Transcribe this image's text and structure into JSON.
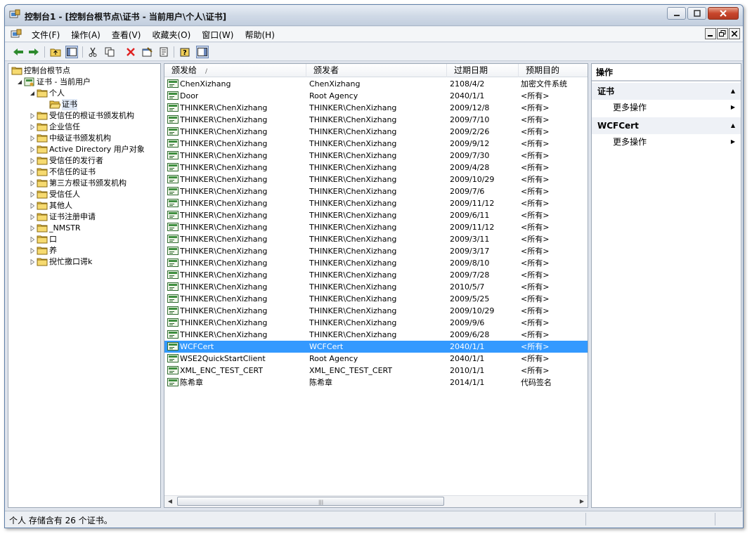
{
  "window": {
    "title": "控制台1 - [控制台根节点\\证书 - 当前用户\\个人\\证书]"
  },
  "menu": [
    "文件(F)",
    "操作(A)",
    "查看(V)",
    "收藏夹(O)",
    "窗口(W)",
    "帮助(H)"
  ],
  "tree": [
    {
      "label": "控制台根节点",
      "level": 0,
      "icon": "folder-icon",
      "twisty": "none"
    },
    {
      "label": "证书 - 当前用户",
      "level": 1,
      "icon": "certificate-store-icon",
      "twisty": "expanded"
    },
    {
      "label": "个人",
      "level": 2,
      "icon": "folder-icon",
      "twisty": "expanded"
    },
    {
      "label": "证书",
      "level": 3,
      "icon": "open-folder-icon",
      "twisty": "none",
      "selected": true
    },
    {
      "label": "受信任的根证书颁发机构",
      "level": 2,
      "icon": "folder-icon",
      "twisty": "collapsed"
    },
    {
      "label": "企业信任",
      "level": 2,
      "icon": "folder-icon",
      "twisty": "collapsed"
    },
    {
      "label": "中级证书颁发机构",
      "level": 2,
      "icon": "folder-icon",
      "twisty": "collapsed"
    },
    {
      "label": "Active Directory 用户对象",
      "level": 2,
      "icon": "folder-icon",
      "twisty": "collapsed"
    },
    {
      "label": "受信任的发行者",
      "level": 2,
      "icon": "folder-icon",
      "twisty": "collapsed"
    },
    {
      "label": "不信任的证书",
      "level": 2,
      "icon": "folder-icon",
      "twisty": "collapsed"
    },
    {
      "label": "第三方根证书颁发机构",
      "level": 2,
      "icon": "folder-icon",
      "twisty": "collapsed"
    },
    {
      "label": "受信任人",
      "level": 2,
      "icon": "folder-icon",
      "twisty": "collapsed"
    },
    {
      "label": "其他人",
      "level": 2,
      "icon": "folder-icon",
      "twisty": "collapsed"
    },
    {
      "label": "证书注册申请",
      "level": 2,
      "icon": "folder-icon",
      "twisty": "collapsed"
    },
    {
      "label": "_NMSTR",
      "level": 2,
      "icon": "folder-icon",
      "twisty": "collapsed"
    },
    {
      "label": "口",
      "level": 2,
      "icon": "folder-icon",
      "twisty": "collapsed"
    },
    {
      "label": "养",
      "level": 2,
      "icon": "folder-icon",
      "twisty": "collapsed"
    },
    {
      "label": "掜忙撽口谔k",
      "level": 2,
      "icon": "folder-icon",
      "twisty": "collapsed"
    }
  ],
  "list": {
    "columns": [
      "颁发给",
      "颁发者",
      "过期日期",
      "预期目的"
    ],
    "sort_indicator": "/",
    "rows": [
      [
        "ChenXizhang",
        "ChenXizhang",
        "2108/4/2",
        "加密文件系统"
      ],
      [
        "Door",
        "Root Agency",
        "2040/1/1",
        "<所有>"
      ],
      [
        "THINKER\\ChenXizhang",
        "THINKER\\ChenXizhang",
        "2009/12/8",
        "<所有>"
      ],
      [
        "THINKER\\ChenXizhang",
        "THINKER\\ChenXizhang",
        "2009/7/10",
        "<所有>"
      ],
      [
        "THINKER\\ChenXizhang",
        "THINKER\\ChenXizhang",
        "2009/2/26",
        "<所有>"
      ],
      [
        "THINKER\\ChenXizhang",
        "THINKER\\ChenXizhang",
        "2009/9/12",
        "<所有>"
      ],
      [
        "THINKER\\ChenXizhang",
        "THINKER\\ChenXizhang",
        "2009/7/30",
        "<所有>"
      ],
      [
        "THINKER\\ChenXizhang",
        "THINKER\\ChenXizhang",
        "2009/4/28",
        "<所有>"
      ],
      [
        "THINKER\\ChenXizhang",
        "THINKER\\ChenXizhang",
        "2009/10/29",
        "<所有>"
      ],
      [
        "THINKER\\ChenXizhang",
        "THINKER\\ChenXizhang",
        "2009/7/6",
        "<所有>"
      ],
      [
        "THINKER\\ChenXizhang",
        "THINKER\\ChenXizhang",
        "2009/11/12",
        "<所有>"
      ],
      [
        "THINKER\\ChenXizhang",
        "THINKER\\ChenXizhang",
        "2009/6/11",
        "<所有>"
      ],
      [
        "THINKER\\ChenXizhang",
        "THINKER\\ChenXizhang",
        "2009/11/12",
        "<所有>"
      ],
      [
        "THINKER\\ChenXizhang",
        "THINKER\\ChenXizhang",
        "2009/3/11",
        "<所有>"
      ],
      [
        "THINKER\\ChenXizhang",
        "THINKER\\ChenXizhang",
        "2009/3/17",
        "<所有>"
      ],
      [
        "THINKER\\ChenXizhang",
        "THINKER\\ChenXizhang",
        "2009/8/10",
        "<所有>"
      ],
      [
        "THINKER\\ChenXizhang",
        "THINKER\\ChenXizhang",
        "2009/7/28",
        "<所有>"
      ],
      [
        "THINKER\\ChenXizhang",
        "THINKER\\ChenXizhang",
        "2010/5/7",
        "<所有>"
      ],
      [
        "THINKER\\ChenXizhang",
        "THINKER\\ChenXizhang",
        "2009/5/25",
        "<所有>"
      ],
      [
        "THINKER\\ChenXizhang",
        "THINKER\\ChenXizhang",
        "2009/10/29",
        "<所有>"
      ],
      [
        "THINKER\\ChenXizhang",
        "THINKER\\ChenXizhang",
        "2009/9/6",
        "<所有>"
      ],
      [
        "THINKER\\ChenXizhang",
        "THINKER\\ChenXizhang",
        "2009/6/28",
        "<所有>"
      ],
      [
        "WCFCert",
        "WCFCert",
        "2040/1/1",
        "<所有>"
      ],
      [
        "WSE2QuickStartClient",
        "Root Agency",
        "2040/1/1",
        "<所有>"
      ],
      [
        "XML_ENC_TEST_CERT",
        "XML_ENC_TEST_CERT",
        "2010/1/1",
        "<所有>"
      ],
      [
        "陈希章",
        "陈希章",
        "2014/1/1",
        "代码签名"
      ]
    ],
    "selected_row": 22
  },
  "actions": {
    "title": "操作",
    "sections": [
      {
        "title": "证书",
        "items": [
          "更多操作"
        ]
      },
      {
        "title": "WCFCert",
        "items": [
          "更多操作"
        ]
      }
    ]
  },
  "status": {
    "text": "个人 存储含有 26 个证书。"
  },
  "colors": {
    "selection": "#3399ff",
    "folder": "#f2cf57",
    "delete": "#e02020"
  },
  "toolbar_icons": [
    "back-arrow-icon",
    "forward-arrow-icon",
    "up-folder-icon",
    "show-hide-tree-icon",
    "cut-icon",
    "copy-icon",
    "delete-icon",
    "properties-icon",
    "export-list-icon",
    "help-icon",
    "show-hide-action-pane-icon"
  ]
}
